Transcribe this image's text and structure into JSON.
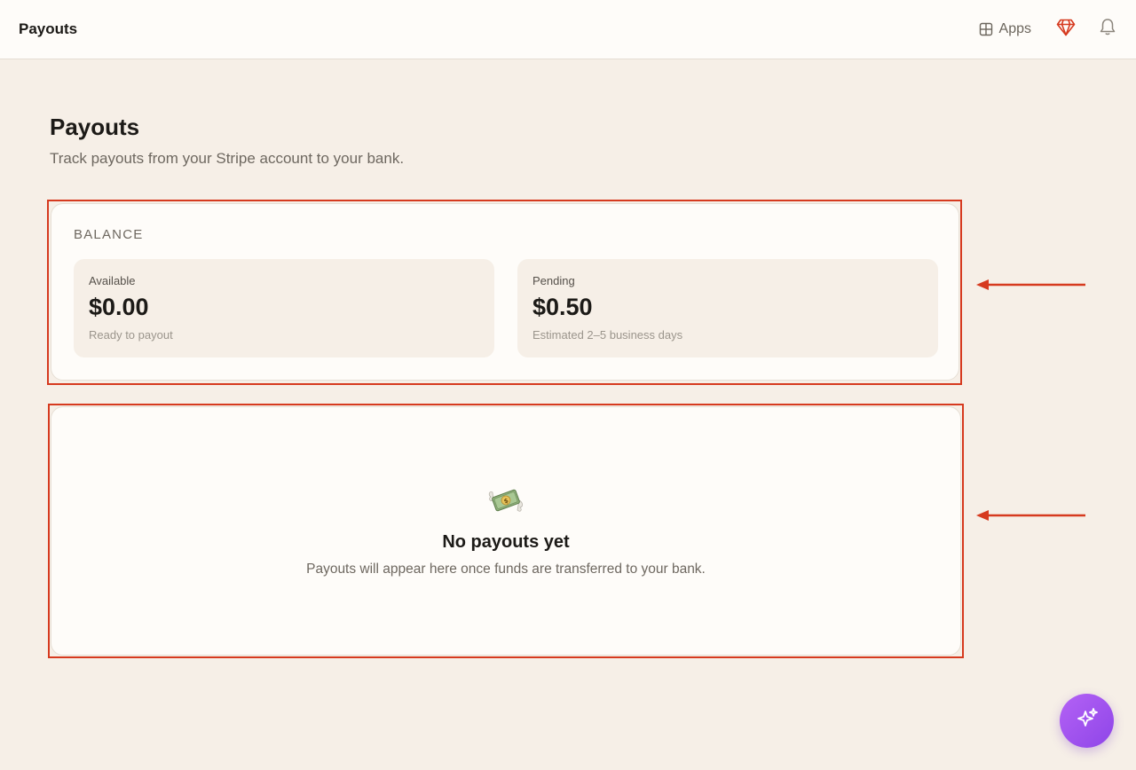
{
  "header": {
    "title": "Payouts",
    "apps_label": "Apps",
    "icons": {
      "apps": "grid-icon",
      "upgrade": "gem-icon",
      "notifications": "bell-icon"
    }
  },
  "page": {
    "title": "Payouts",
    "subtitle": "Track payouts from your Stripe account to your bank."
  },
  "balance": {
    "label": "BALANCE",
    "available": {
      "label": "Available",
      "amount": "$0.00",
      "note": "Ready to payout"
    },
    "pending": {
      "label": "Pending",
      "amount": "$0.50",
      "note": "Estimated 2–5 business days"
    }
  },
  "empty_state": {
    "icon": "money-with-wings-icon",
    "title": "No payouts yet",
    "message": "Payouts will appear here once funds are transferred to your bank."
  },
  "assistant": {
    "icon": "sparkles-icon"
  },
  "colors": {
    "background": "#f6efe7",
    "card": "#fefcf9",
    "annotation": "#d63a1f",
    "accent": "#a855f7"
  }
}
